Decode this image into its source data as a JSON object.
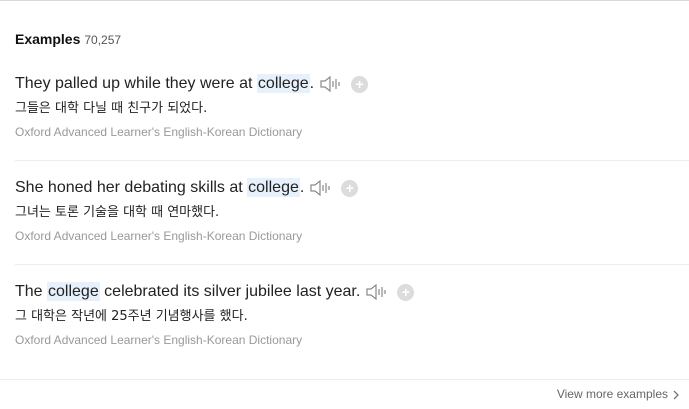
{
  "section": {
    "title": "Examples",
    "count": "70,257"
  },
  "examples": [
    {
      "before": "They palled up while they were at ",
      "highlight": "college",
      "after": ".",
      "translation": "그들은 대학 다닐 때 친구가 되었다.",
      "source": "Oxford Advanced Learner's English-Korean Dictionary",
      "audio_icon": "speaker-icon",
      "add_icon": "plus-circle-icon"
    },
    {
      "before": "She honed her debating skills at ",
      "highlight": "college",
      "after": ".",
      "translation": "그녀는 토론 기술을 대학 때 연마했다.",
      "source": "Oxford Advanced Learner's English-Korean Dictionary",
      "audio_icon": "speaker-icon",
      "add_icon": "plus-circle-icon"
    },
    {
      "before": "The ",
      "highlight": "college",
      "after": " celebrated its silver jubilee last year.",
      "translation": "그 대학은 작년에 25주년 기념행사를 했다.",
      "source": "Oxford Advanced Learner's English-Korean Dictionary",
      "audio_icon": "speaker-icon",
      "add_icon": "plus-circle-icon"
    }
  ],
  "footer": {
    "view_more_label": "View more examples",
    "chevron_icon": "chevron-right-icon"
  },
  "colors": {
    "highlight_bg": "#e7f1fb",
    "source_text": "#999999",
    "add_icon_bg": "#dcdcdc"
  }
}
